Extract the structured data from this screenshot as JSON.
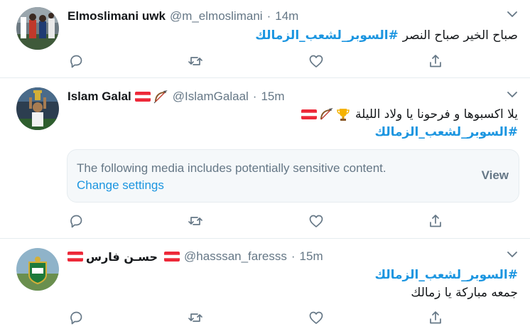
{
  "colors": {
    "link": "#1b95e0",
    "muted": "#657786",
    "divider": "#e6ecf0",
    "media_bg": "#f5f8fa"
  },
  "tweets": [
    {
      "name": "Elmoslimani uwk",
      "handle": "@m_elmoslimani",
      "separator": "·",
      "time": "14m",
      "text": "صباح الخير صباح النصر",
      "hashtag": "#السوبر_لشعب_الزمالك",
      "avatar_icon": "stadium-player-avatar"
    },
    {
      "name": "Islam Galal",
      "name_icons": [
        "austria-flag-icon",
        "bow-and-arrow-icon"
      ],
      "handle": "@IslamGalaal",
      "separator": "·",
      "time": "15m",
      "text": "يلا اكسبوها و فرحونا يا ولاد الليلة",
      "text_icons": [
        "trophy-icon",
        "bow-and-arrow-icon",
        "austria-flag-icon"
      ],
      "hashtag": "#السوبر_لشعب_الزمالك",
      "media_notice": {
        "message": "The following media includes potentially sensitive content.",
        "link": "Change settings",
        "button": "View"
      },
      "avatar_icon": "trophy-player-avatar"
    },
    {
      "name": "حسـن فارس",
      "name_icons": [
        "austria-flag-icon",
        "austria-flag-icon"
      ],
      "handle": "@hasssan_faresss",
      "separator": "·",
      "time": "15m",
      "hashtag": "#السوبر_لشعب_الزمالك",
      "text": "جمعه مباركة يا زمالك",
      "avatar_icon": "club-crest-avatar"
    }
  ],
  "actions": [
    "reply-icon",
    "retweet-icon",
    "like-icon",
    "share-icon"
  ]
}
